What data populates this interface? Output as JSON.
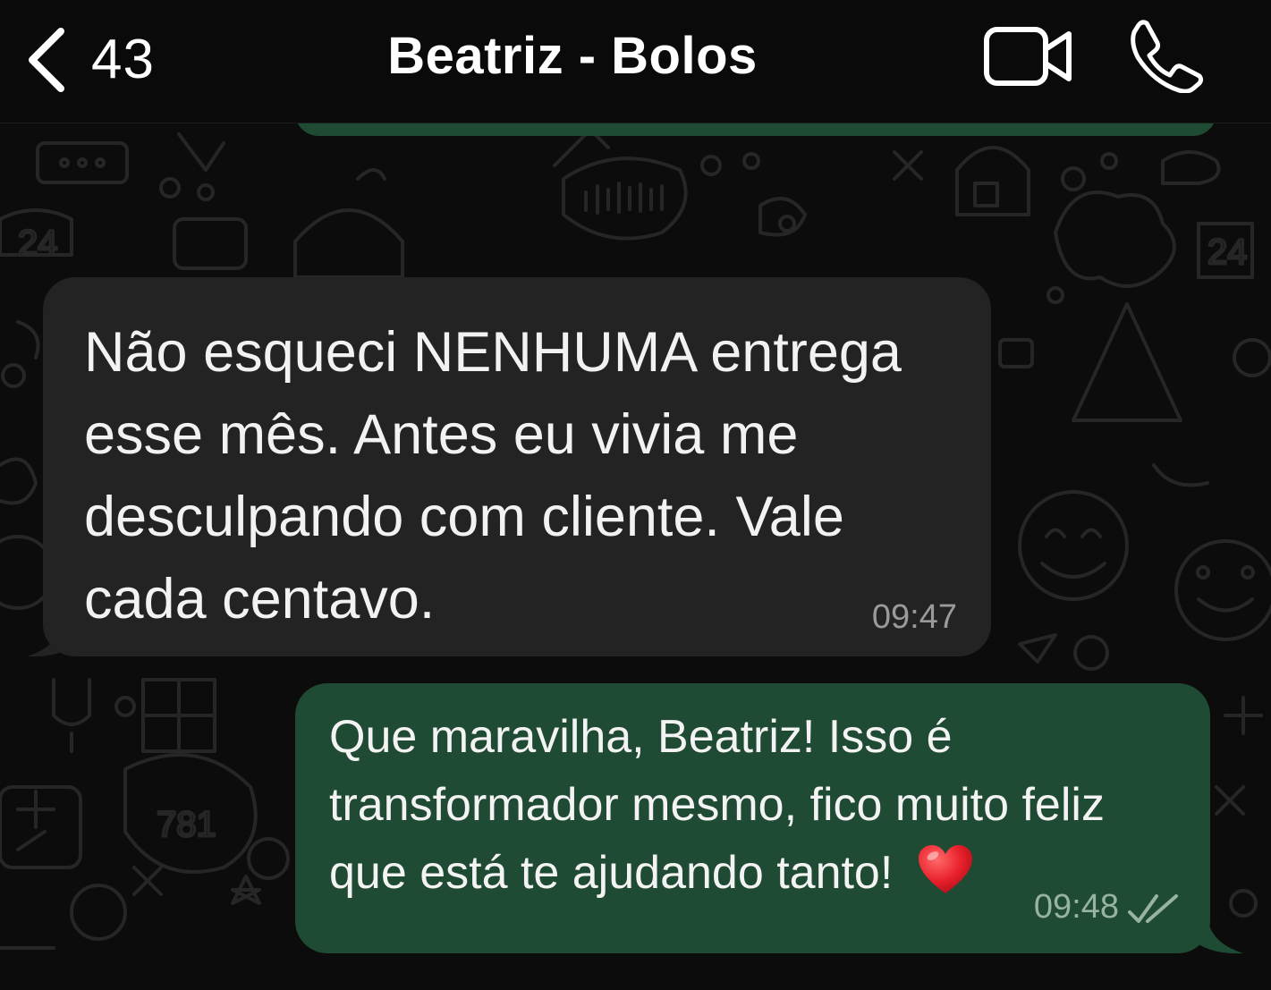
{
  "header": {
    "unread_count": "43",
    "contact_name": "Beatriz - Bolos",
    "back_icon": "chevron-left-icon",
    "video_icon": "video-camera-icon",
    "call_icon": "phone-icon"
  },
  "messages": [
    {
      "direction": "incoming",
      "text": "Não esqueci NENHUMA entrega esse mês. Antes eu vivia me desculpando com cliente. Vale cada centavo.",
      "time": "09:47"
    },
    {
      "direction": "outgoing",
      "text": "Que maravilha, Beatriz! Isso é transformador mesmo, fico muito feliz que está te ajudando tanto!",
      "emoji": "❤️",
      "time": "09:48",
      "status": "read"
    }
  ],
  "colors": {
    "background": "#0c0c0c",
    "incoming_bubble": "#232323",
    "outgoing_bubble": "#1f4a33",
    "doodle_stroke": "#262626"
  }
}
